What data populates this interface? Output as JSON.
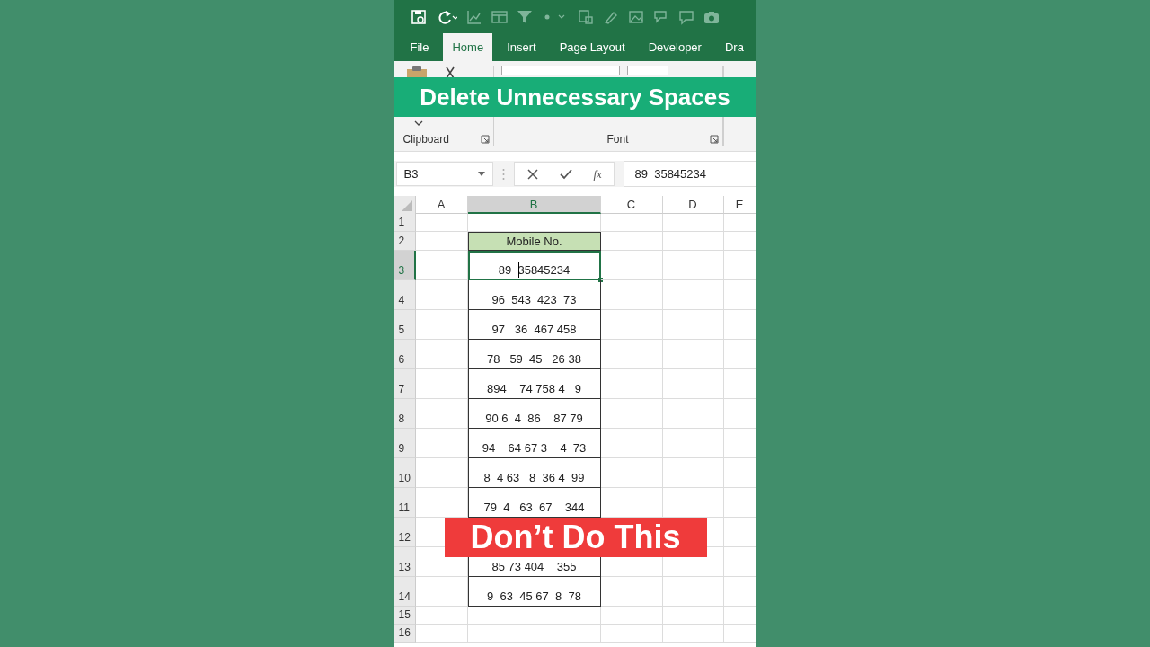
{
  "tabs": [
    {
      "label": "File",
      "selected": false
    },
    {
      "label": "Home",
      "selected": true
    },
    {
      "label": "Insert",
      "selected": false
    },
    {
      "label": "Page Layout",
      "selected": false
    },
    {
      "label": "Developer",
      "selected": false
    },
    {
      "label": "Dra",
      "selected": false
    }
  ],
  "ribbon_groups": [
    {
      "label": "Clipboard"
    },
    {
      "label": "Font"
    }
  ],
  "name_box": "B3",
  "function_label": "fx",
  "formula": "89  35845234",
  "columns": [
    {
      "label": "A",
      "selected": false
    },
    {
      "label": "B",
      "selected": true
    },
    {
      "label": "C",
      "selected": false
    },
    {
      "label": "D",
      "selected": false
    },
    {
      "label": "E",
      "selected": false
    }
  ],
  "rows": [
    {
      "label": "1",
      "selected": false,
      "kind": "blank"
    },
    {
      "label": "2",
      "selected": false,
      "kind": "header",
      "b": "Mobile No."
    },
    {
      "label": "3",
      "selected": true,
      "kind": "data",
      "b": "89  35845234"
    },
    {
      "label": "4",
      "selected": false,
      "kind": "data",
      "b": "96  543  423  73"
    },
    {
      "label": "5",
      "selected": false,
      "kind": "data",
      "b": "97   36  467 458"
    },
    {
      "label": "6",
      "selected": false,
      "kind": "data",
      "b": "78   59  45   26 38"
    },
    {
      "label": "7",
      "selected": false,
      "kind": "data",
      "b": "894    74 758 4   9"
    },
    {
      "label": "8",
      "selected": false,
      "kind": "data",
      "b": "90 6  4  86    87 79"
    },
    {
      "label": "9",
      "selected": false,
      "kind": "data",
      "b": "94    64 67 3    4  73"
    },
    {
      "label": "10",
      "selected": false,
      "kind": "data",
      "b": "8  4 63   8  36 4  99"
    },
    {
      "label": "11",
      "selected": false,
      "kind": "data",
      "b": "79  4   63  67    344"
    },
    {
      "label": "12",
      "selected": false,
      "kind": "covered"
    },
    {
      "label": "13",
      "selected": false,
      "kind": "data",
      "b": "85 73 404    355"
    },
    {
      "label": "14",
      "selected": false,
      "kind": "data",
      "b": "9  63  45 67  8  78"
    },
    {
      "label": "15",
      "selected": false,
      "kind": "blank"
    },
    {
      "label": "16",
      "selected": false,
      "kind": "blank"
    }
  ],
  "overlays": [
    {
      "kind": "title_banner",
      "text": "Delete Unnecessary Spaces"
    },
    {
      "kind": "warning_banner",
      "text": "Don’t Do This"
    }
  ]
}
